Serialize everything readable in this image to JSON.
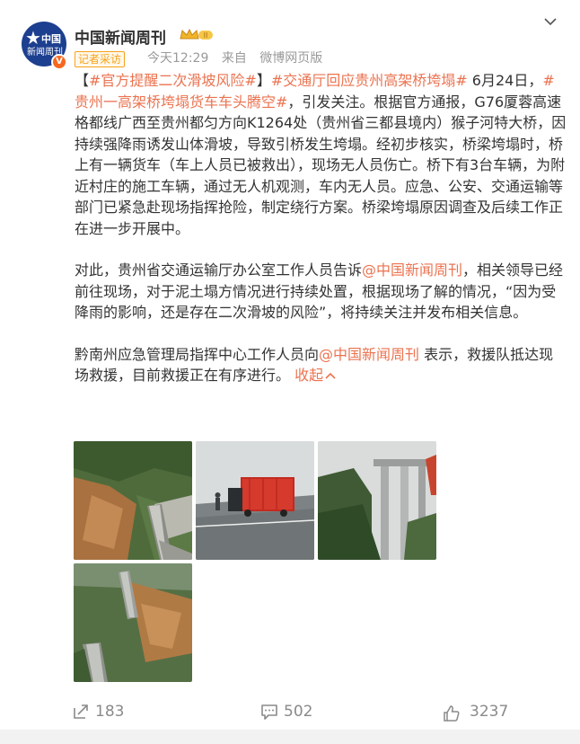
{
  "account": {
    "name": "中国新闻周刊",
    "avatar_line1": "中国",
    "avatar_line2": "新闻周刊",
    "verified_mark": "V",
    "badge": "记者采访",
    "time": "今天12:29",
    "source_prefix": "来自",
    "source": "微博网页版"
  },
  "post": {
    "p1": {
      "open_bracket": "【",
      "tag1": "#官方提醒二次滑坡风险#",
      "close_bracket": "】",
      "tag2": "#交通厅回应贵州高架桥垮塌#",
      "text1": " 6月24日，",
      "tag3": "#贵州一高架桥垮塌货车车头腾空#",
      "text2": "，引发关注。根据官方通报，G76厦蓉高速格都线广西至贵州都匀方向K1264处（贵州省三都县境内）猴子河特大桥，因持续强降雨诱发山体滑坡，导致引桥发生垮塌。经初步核实，桥梁垮塌时，桥上有一辆货车（车上人员已被救出），现场无人员伤亡。桥下有3台车辆，为附近村庄的施工车辆，通过无人机观测，车内无人员。应急、公安、交通运输等部门已紧急赴现场指挥抢险，制定绕行方案。桥梁垮塌原因调查及后续工作正在进一步开展中。"
    },
    "p2": {
      "text1": "对此，贵州省交通运输厅办公室工作人员告诉",
      "mention": "@中国新闻周刊",
      "text2": "，相关领导已经前往现场，对于泥土塌方情况进行持续处置，根据现场了解的情况，“因为受降雨的影响，还是存在二次滑坡的风险”，将持续关注并发布相关信息。"
    },
    "p3": {
      "text1": "黔南州应急管理局指挥中心工作人员向",
      "mention": "@中国新闻周刊",
      "text2": " 表示，救援队抵达现场救援，目前救援正在有序进行。 ",
      "fold": "收起"
    }
  },
  "photos": [
    {
      "name": "landslide-aerial-photo"
    },
    {
      "name": "truck-on-bridge-edge-photo"
    },
    {
      "name": "bridge-piers-photo"
    },
    {
      "name": "collapsed-bridge-aerial-photo"
    }
  ],
  "actions": {
    "repost_count": "183",
    "comment_count": "502",
    "like_count": "3237"
  },
  "colors": {
    "link": "#eb7350",
    "meta": "#9a9a9a",
    "badge": "#f7a21b",
    "verified": "#f7671d"
  },
  "icons": [
    "chevron-down-icon",
    "crown-icon",
    "repost-icon",
    "comment-icon",
    "like-icon"
  ]
}
